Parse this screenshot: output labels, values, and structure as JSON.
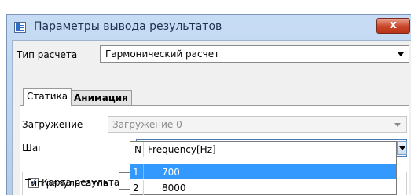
{
  "window": {
    "title": "Параметры вывода результатов",
    "close_label": "x"
  },
  "calc_type": {
    "label": "Тип расчета",
    "value": "Гармонический расчет"
  },
  "tabs": [
    {
      "label": "Статика",
      "active": true
    },
    {
      "label": "Анимация",
      "active": false
    }
  ],
  "loading": {
    "label": "Загружение",
    "value": "Загружение 0"
  },
  "step": {
    "label": "Шаг",
    "n": "1",
    "separator": "-",
    "frequency": "700"
  },
  "result_map": {
    "checked": true,
    "label": "Карта результатов"
  },
  "result_type": {
    "label": "Тип результатов"
  },
  "dropdown": {
    "header_n": "N",
    "header_freq": "Frequency[Hz]",
    "rows": [
      {
        "n": "1",
        "freq": "700",
        "selected": true
      },
      {
        "n": "2",
        "freq": "8000",
        "selected": false
      }
    ]
  },
  "colors": {
    "selection": "#3399ff",
    "close_button": "#c9452a",
    "titlebar": "#c7dcf4"
  }
}
